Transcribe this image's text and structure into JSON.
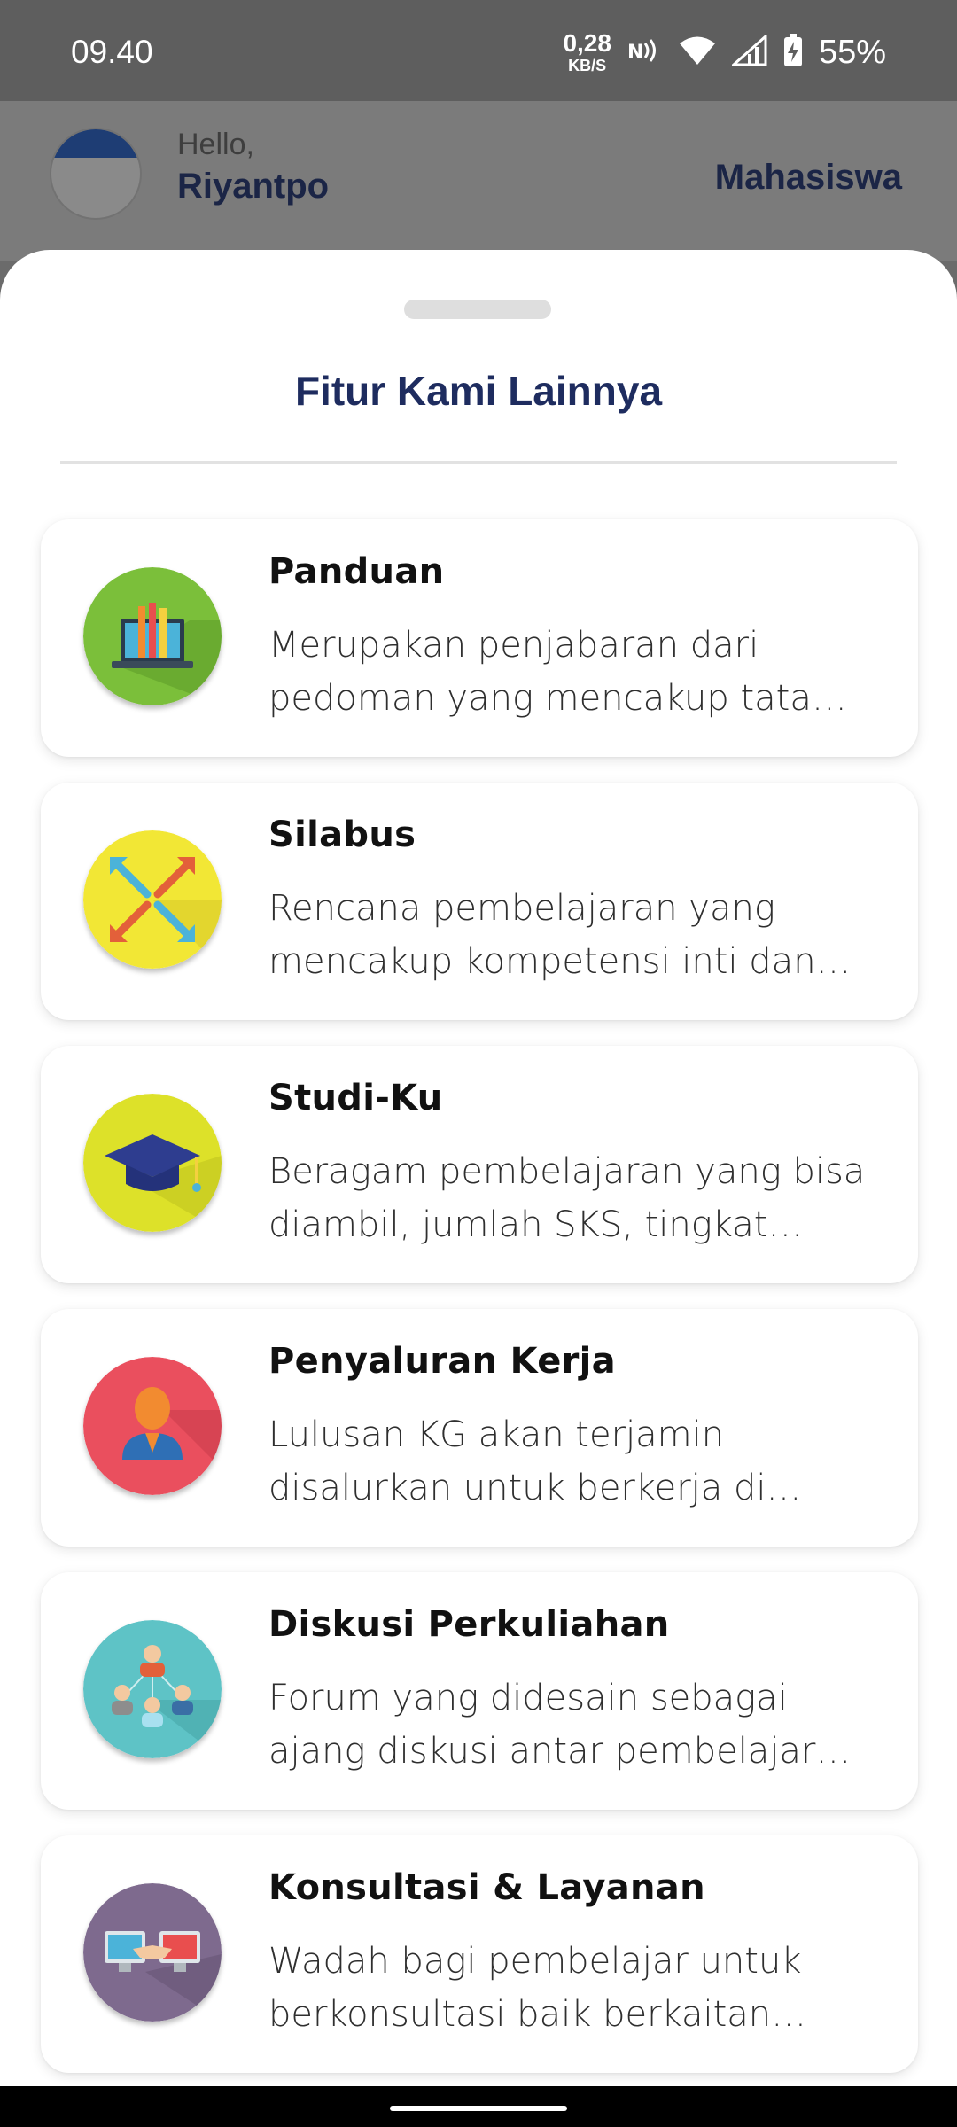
{
  "status_bar": {
    "time": "09.40",
    "net_speed_value": "0,28",
    "net_speed_unit": "KB/S",
    "battery_percent": "55%",
    "icons": [
      "nfc-icon",
      "wifi-icon",
      "signal-icon",
      "battery-charging-icon"
    ]
  },
  "header": {
    "greeting": "Hello,",
    "user_name": "Riyantpo",
    "role": "Mahasiswa"
  },
  "sheet": {
    "title": "Fitur Kami Lainnya",
    "features": [
      {
        "title": "Panduan",
        "description": "Merupakan penjabaran dari pedoman yang mencakup tata cara",
        "icon": "guide-laptop-icon",
        "color": "#7bbf3a"
      },
      {
        "title": "Silabus",
        "description": "Rencana pembelajaran yang mencakup kompetensi inti dan dasar",
        "icon": "syllabus-arrows-icon",
        "color": "#f2e735"
      },
      {
        "title": "Studi-Ku",
        "description": "Beragam pembelajaran yang bisa diambil, jumlah SKS, tingkat kesulitan",
        "icon": "graduation-cap-icon",
        "color": "#dde129"
      },
      {
        "title": "Penyaluran Kerja",
        "description": "Lulusan KG akan terjamin disalurkan untuk berkerja di perusahaan",
        "icon": "job-person-icon",
        "color": "#ea4f5e"
      },
      {
        "title": "Diskusi Perkuliahan",
        "description": "Forum yang didesain sebagai ajang diskusi antar pembelajar dan dosen",
        "icon": "discussion-group-icon",
        "color": "#5ec3c6"
      },
      {
        "title": "Konsultasi & Layanan",
        "description": "Wadah bagi pembelajar untuk berkonsultasi baik berkaitan dengan studi",
        "icon": "consultation-handshake-icon",
        "color": "#7e6a8e"
      }
    ]
  }
}
